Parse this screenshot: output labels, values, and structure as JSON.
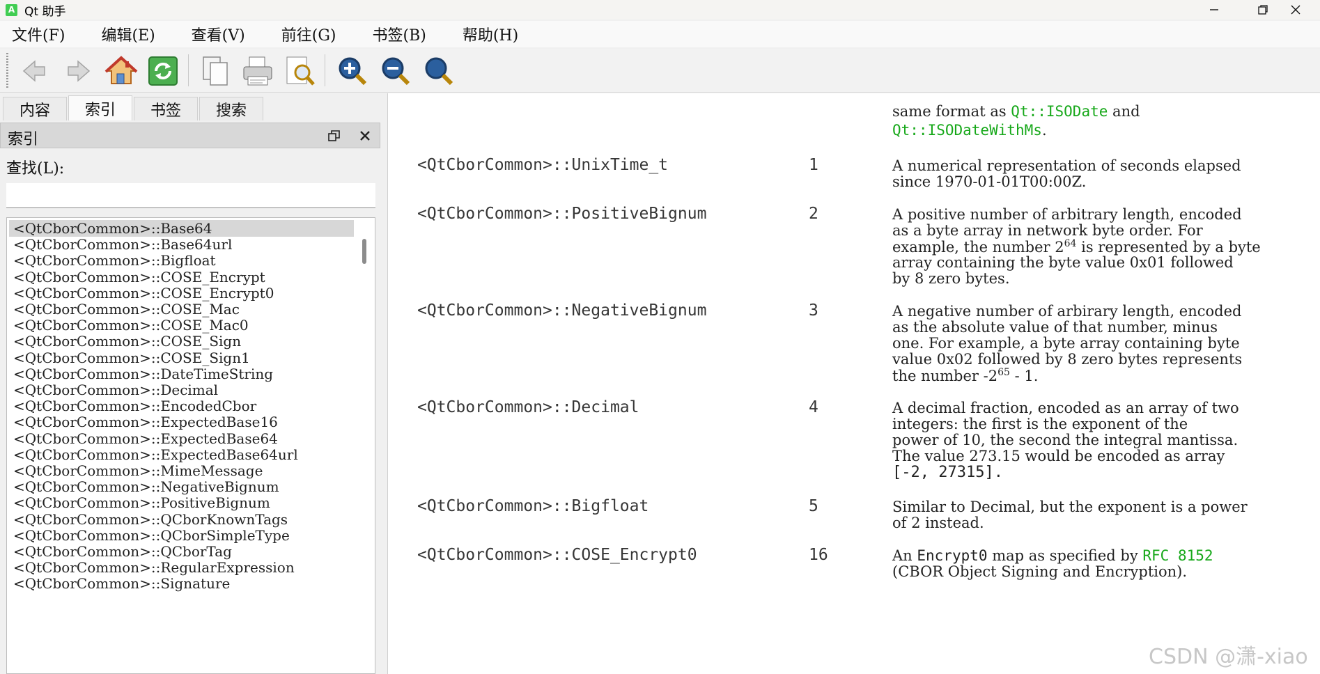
{
  "window": {
    "app_icon_text": "A",
    "title": "Qt 助手"
  },
  "menu": {
    "items": [
      "文件(F)",
      "编辑(E)",
      "查看(V)",
      "前往(G)",
      "书签(B)",
      "帮助(H)"
    ]
  },
  "toolbar": {
    "buttons": [
      "back-icon",
      "forward-icon",
      "home-icon",
      "sync-icon",
      "copy-icon",
      "print-icon",
      "find-icon",
      "zoom-in-icon",
      "zoom-out-icon",
      "zoom-reset-icon"
    ]
  },
  "tabs": {
    "items": [
      "内容",
      "索引",
      "书签",
      "搜索"
    ],
    "active": "索引"
  },
  "dock": {
    "title": "索引"
  },
  "search": {
    "label": "查找(L):",
    "value": "",
    "placeholder": ""
  },
  "index": {
    "selected": "<QtCborCommon>::Base64",
    "items": [
      "<QtCborCommon>::Base64",
      "<QtCborCommon>::Base64url",
      "<QtCborCommon>::Bigfloat",
      "<QtCborCommon>::COSE_Encrypt",
      "<QtCborCommon>::COSE_Encrypt0",
      "<QtCborCommon>::COSE_Mac",
      "<QtCborCommon>::COSE_Mac0",
      "<QtCborCommon>::COSE_Sign",
      "<QtCborCommon>::COSE_Sign1",
      "<QtCborCommon>::DateTimeString",
      "<QtCborCommon>::Decimal",
      "<QtCborCommon>::EncodedCbor",
      "<QtCborCommon>::ExpectedBase16",
      "<QtCborCommon>::ExpectedBase64",
      "<QtCborCommon>::ExpectedBase64url",
      "<QtCborCommon>::MimeMessage",
      "<QtCborCommon>::NegativeBignum",
      "<QtCborCommon>::PositiveBignum",
      "<QtCborCommon>::QCborKnownTags",
      "<QtCborCommon>::QCborSimpleType",
      "<QtCborCommon>::QCborTag",
      "<QtCborCommon>::RegularExpression",
      "<QtCborCommon>::Signature"
    ]
  },
  "content": {
    "top_desc": {
      "line1_prefix": "same format as ",
      "line1_link": "Qt::ISODate",
      "line1_suffix": " and",
      "line2_link": "Qt::ISODateWithMs",
      "line2_suffix": "."
    },
    "rows": [
      {
        "name": "<QtCborCommon>::UnixTime_t",
        "value": "1",
        "lines": [
          "A numerical representation of seconds elapsed",
          "since 1970-01-01T00:00Z."
        ]
      },
      {
        "name": "<QtCborCommon>::PositiveBignum",
        "value": "2",
        "lines": [
          "A positive number of arbitrary length, encoded",
          "as a byte array in network byte order. For"
        ],
        "sup_line": {
          "before": "example, the number 2",
          "sup": "64",
          "after": " is represented by a byte"
        },
        "lines2": [
          "array containing the byte value 0x01 followed",
          "by 8 zero bytes."
        ]
      },
      {
        "name": "<QtCborCommon>::NegativeBignum",
        "value": "3",
        "lines": [
          "A negative number of arbirary length, encoded",
          "as the absolute value of that number, minus",
          "one. For example, a byte array containing byte",
          "value 0x02 followed by 8 zero bytes represents"
        ],
        "sup_line": {
          "before": "the number -2",
          "sup": "65",
          "after": " - 1."
        }
      },
      {
        "name": "<QtCborCommon>::Decimal",
        "value": "4",
        "lines": [
          "A decimal fraction, encoded as an array of two",
          "integers: the first is the exponent of the",
          "power of 10, the second the integral mantissa.",
          "The value 273.15 would be encoded as array"
        ],
        "code_line": "[-2, 27315]."
      },
      {
        "name": "<QtCborCommon>::Bigfloat",
        "value": "5",
        "lines": [
          "Similar to Decimal, but the exponent is a power",
          "of 2 instead."
        ]
      },
      {
        "name": "<QtCborCommon>::COSE_Encrypt0",
        "value": "16",
        "link_line": {
          "before": "An ",
          "code": "Encrypt0",
          "middle": " map as specified by ",
          "link": "RFC 8152"
        },
        "lines": [
          "(CBOR Object Signing and Encryption)."
        ]
      }
    ]
  },
  "watermark": "CSDN @潇-xiao"
}
